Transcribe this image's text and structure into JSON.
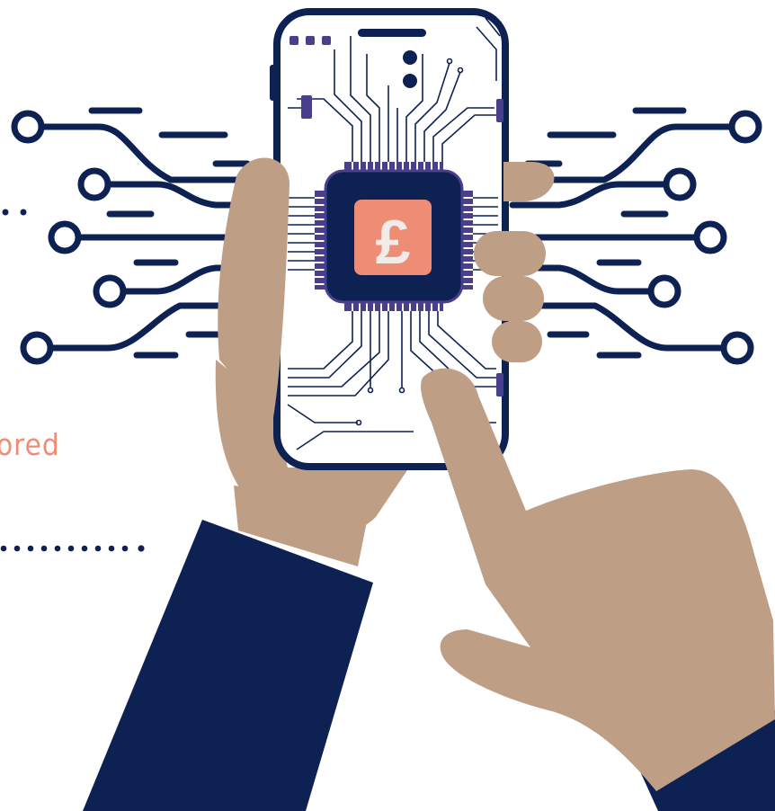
{
  "caption": {
    "fragment": "ored",
    "tick": "."
  },
  "chip": {
    "symbol": "£",
    "icon": "pound-sterling-icon"
  },
  "colors": {
    "navy": "#0d2253",
    "skin": "#bf9e86",
    "accent": "#ef8c76",
    "chip_pins": "#4a3f8c",
    "background": "#ffffff"
  }
}
